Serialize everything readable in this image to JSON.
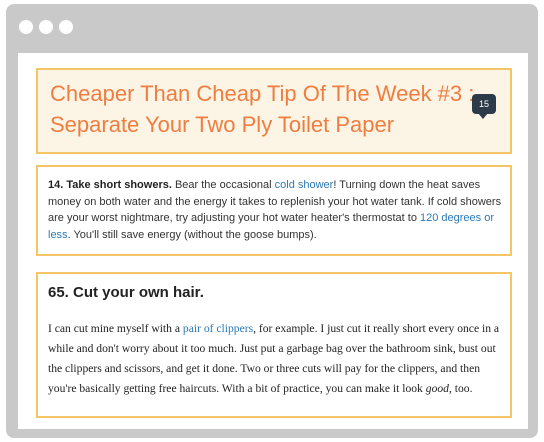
{
  "window": {
    "controls": [
      "close",
      "minimize",
      "maximize"
    ]
  },
  "article": {
    "headline": "Cheaper Than Cheap Tip Of The Week #3 : Separate Your Two Ply Toilet Paper",
    "comment_count": "15"
  },
  "tip14": {
    "number_title": "14. Take short showers.",
    "text1": " Bear the occasional ",
    "link1": "cold shower",
    "text2": "! Turning down the heat saves money on both water and the energy it takes to replenish your hot water tank. If cold showers are your worst nightmare, try adjusting your hot water heater's thermostat to ",
    "link2": "120 degrees or less",
    "text3": ". You'll still save energy (without the goose bumps)."
  },
  "tip65": {
    "title": "65. Cut your own hair.",
    "text1": "I can cut mine myself with a ",
    "link": "pair of clippers",
    "text2": ", for example. I just cut it really short every once in a while and don't worry about it too much. Just put a garbage bag over the bathroom sink, bust out the clippers and scissors, and get it done. Two or three cuts will pay for the clippers, and then you're basically getting free haircuts. With a bit of practice, you can make it look ",
    "emphasis": "good",
    "text3": ", too."
  },
  "colors": {
    "accent_orange": "#ef7d40",
    "card_border": "#f5c465",
    "link_blue": "#2c79b7",
    "bubble": "#2d3a49"
  }
}
